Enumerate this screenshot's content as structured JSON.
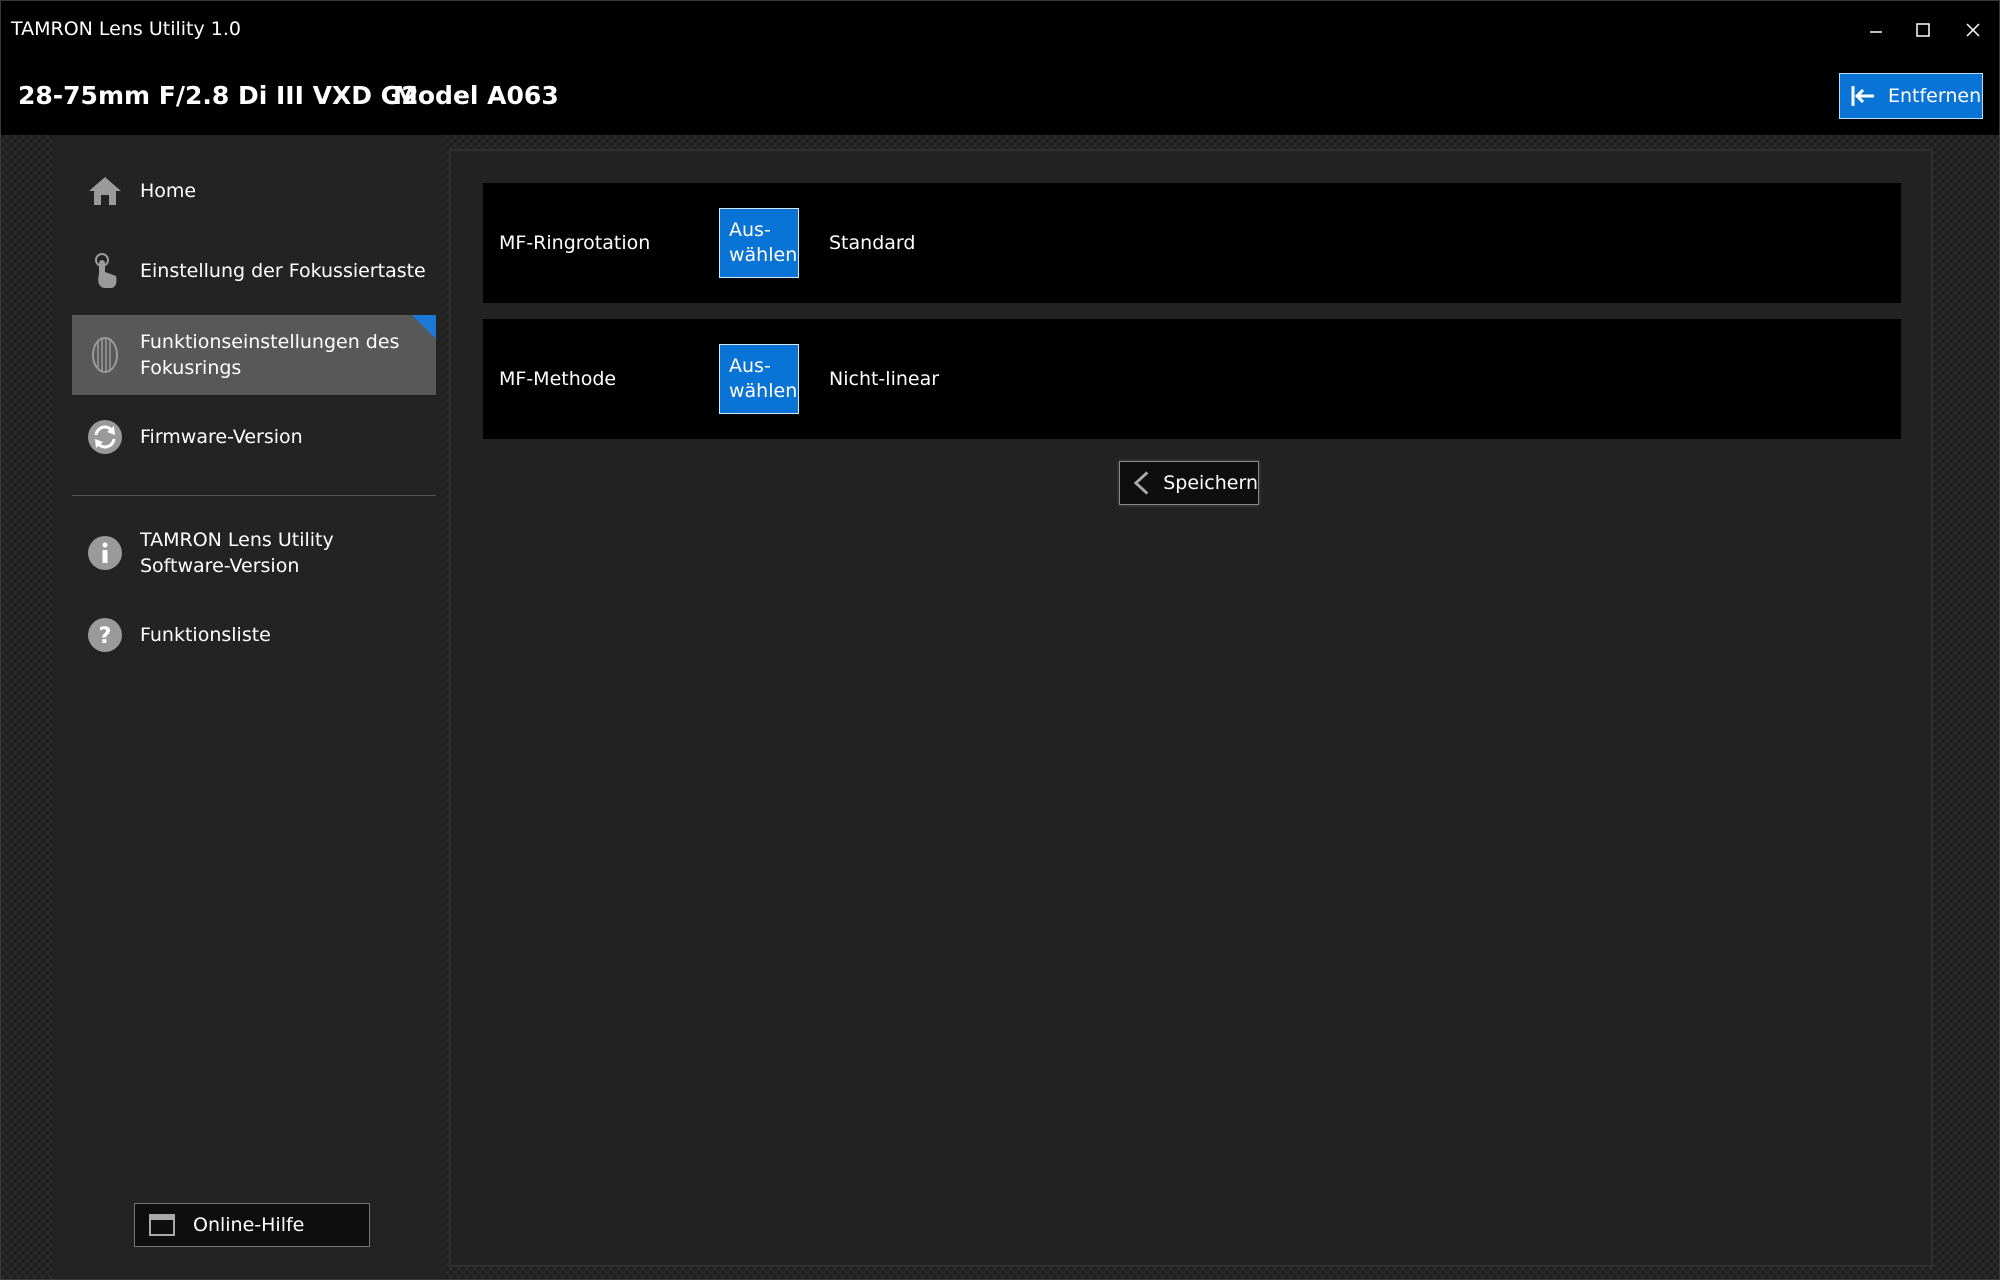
{
  "window": {
    "title": "TAMRON Lens Utility 1.0"
  },
  "header": {
    "lens_name": "28-75mm F/2.8 Di III VXD G2",
    "model": "Model A063",
    "remove_label": "Entfernen"
  },
  "sidebar": {
    "items": [
      {
        "label": "Home",
        "icon": "home-icon"
      },
      {
        "label": "Einstellung der Fokussiertaste",
        "icon": "touch-hand-icon"
      },
      {
        "label_line1": "Funktionseinstellungen des",
        "label_line2": "Fokusrings",
        "icon": "focus-ring-icon",
        "active": true
      },
      {
        "label": "Firmware-Version",
        "icon": "refresh-icon"
      },
      {
        "label_line1": "TAMRON Lens Utility",
        "label_line2": "Software-Version",
        "icon": "info-icon"
      },
      {
        "label": "Funktionsliste",
        "icon": "help-icon"
      }
    ],
    "online_help_label": "Online-Hilfe"
  },
  "settings": [
    {
      "label": "MF-Ringrotation",
      "button_line1": "Aus-",
      "button_line2": "wählen",
      "value": "Standard"
    },
    {
      "label": "MF-Methode",
      "button_line1": "Aus-",
      "button_line2": "wählen",
      "value": "Nicht-linear"
    }
  ],
  "save_label": "Speichern",
  "colors": {
    "accent": "#0a74d6",
    "active_nav": "#585858",
    "background": "#000000",
    "panel": "#222222"
  }
}
